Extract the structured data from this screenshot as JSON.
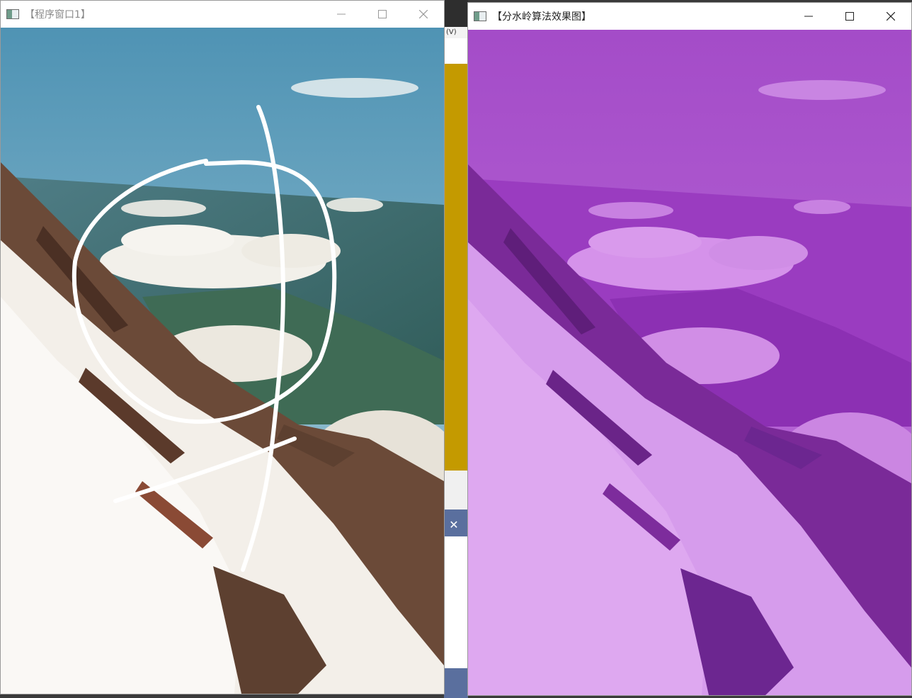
{
  "background_app": {
    "menu_fragment": "(V)",
    "dialog_close_glyph": "✕"
  },
  "window_left": {
    "title": "【程序窗口1】",
    "state": "inactive",
    "icon": "app-window-icon",
    "content": "mountain-photo-with-white-scribble-markers"
  },
  "window_right": {
    "title": "【分水岭算法效果图】",
    "state": "active",
    "icon": "app-window-icon",
    "content": "watershed-result-purple-overlay"
  },
  "caption_icons": [
    "minimize-icon",
    "maximize-icon",
    "close-icon"
  ],
  "colors": {
    "sky": "#5b9bb5",
    "snow": "#f4f1ec",
    "rock": "#6b4a38",
    "marker": "#ffffff",
    "overlay_purple": "#b23cd2",
    "gold_bar": "#c49a00"
  }
}
